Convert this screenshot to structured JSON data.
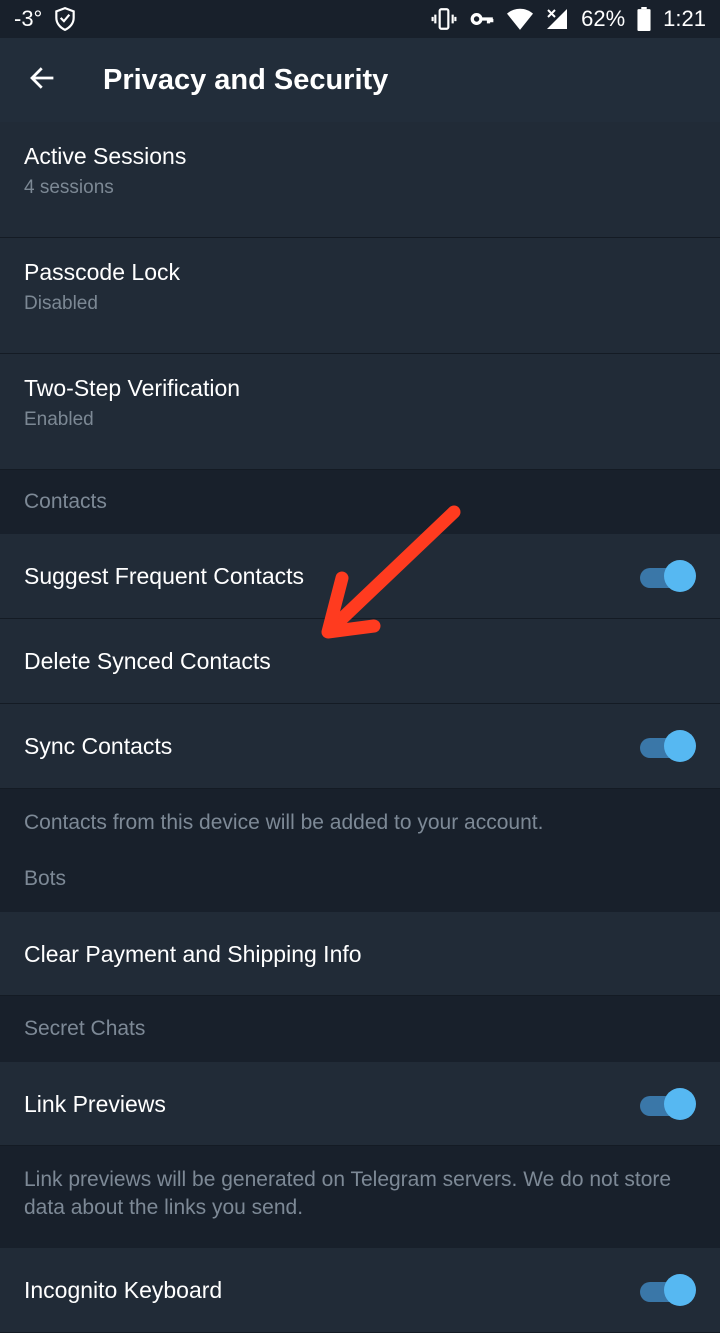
{
  "status_bar": {
    "temperature": "-3°",
    "battery_percent": "62%",
    "time": "1:21",
    "icons": [
      "shield-icon",
      "vibrate-icon",
      "vpn-key-icon",
      "wifi-icon",
      "signal-icon",
      "battery-icon"
    ]
  },
  "app_bar": {
    "back_icon": "arrow-left-icon",
    "title": "Privacy and Security"
  },
  "security": {
    "active_sessions": {
      "label": "Active Sessions",
      "value": "4 sessions"
    },
    "passcode_lock": {
      "label": "Passcode Lock",
      "value": "Disabled"
    },
    "two_step": {
      "label": "Two-Step Verification",
      "value": "Enabled"
    }
  },
  "contacts": {
    "header": "Contacts",
    "suggest_frequent": {
      "label": "Suggest Frequent Contacts",
      "enabled": true
    },
    "delete_synced": {
      "label": "Delete Synced Contacts"
    },
    "sync_contacts": {
      "label": "Sync Contacts",
      "enabled": true
    },
    "info": "Contacts from this device will be added to your account."
  },
  "bots": {
    "header": "Bots",
    "clear_payment": {
      "label": "Clear Payment and Shipping Info"
    }
  },
  "secret_chats": {
    "header": "Secret Chats",
    "link_previews": {
      "label": "Link Previews",
      "enabled": true
    },
    "info": "Link previews will be generated on Telegram servers. We do not store data about the links you send.",
    "incognito_keyboard": {
      "label": "Incognito Keyboard",
      "enabled": true
    }
  },
  "annotation": {
    "color": "#ff3b1f",
    "icon": "red-arrow-annotation"
  },
  "colors": {
    "toggle_track": "#3a77a8",
    "toggle_thumb": "#56b8f2",
    "background": "#18202b",
    "row": "#212b37"
  }
}
